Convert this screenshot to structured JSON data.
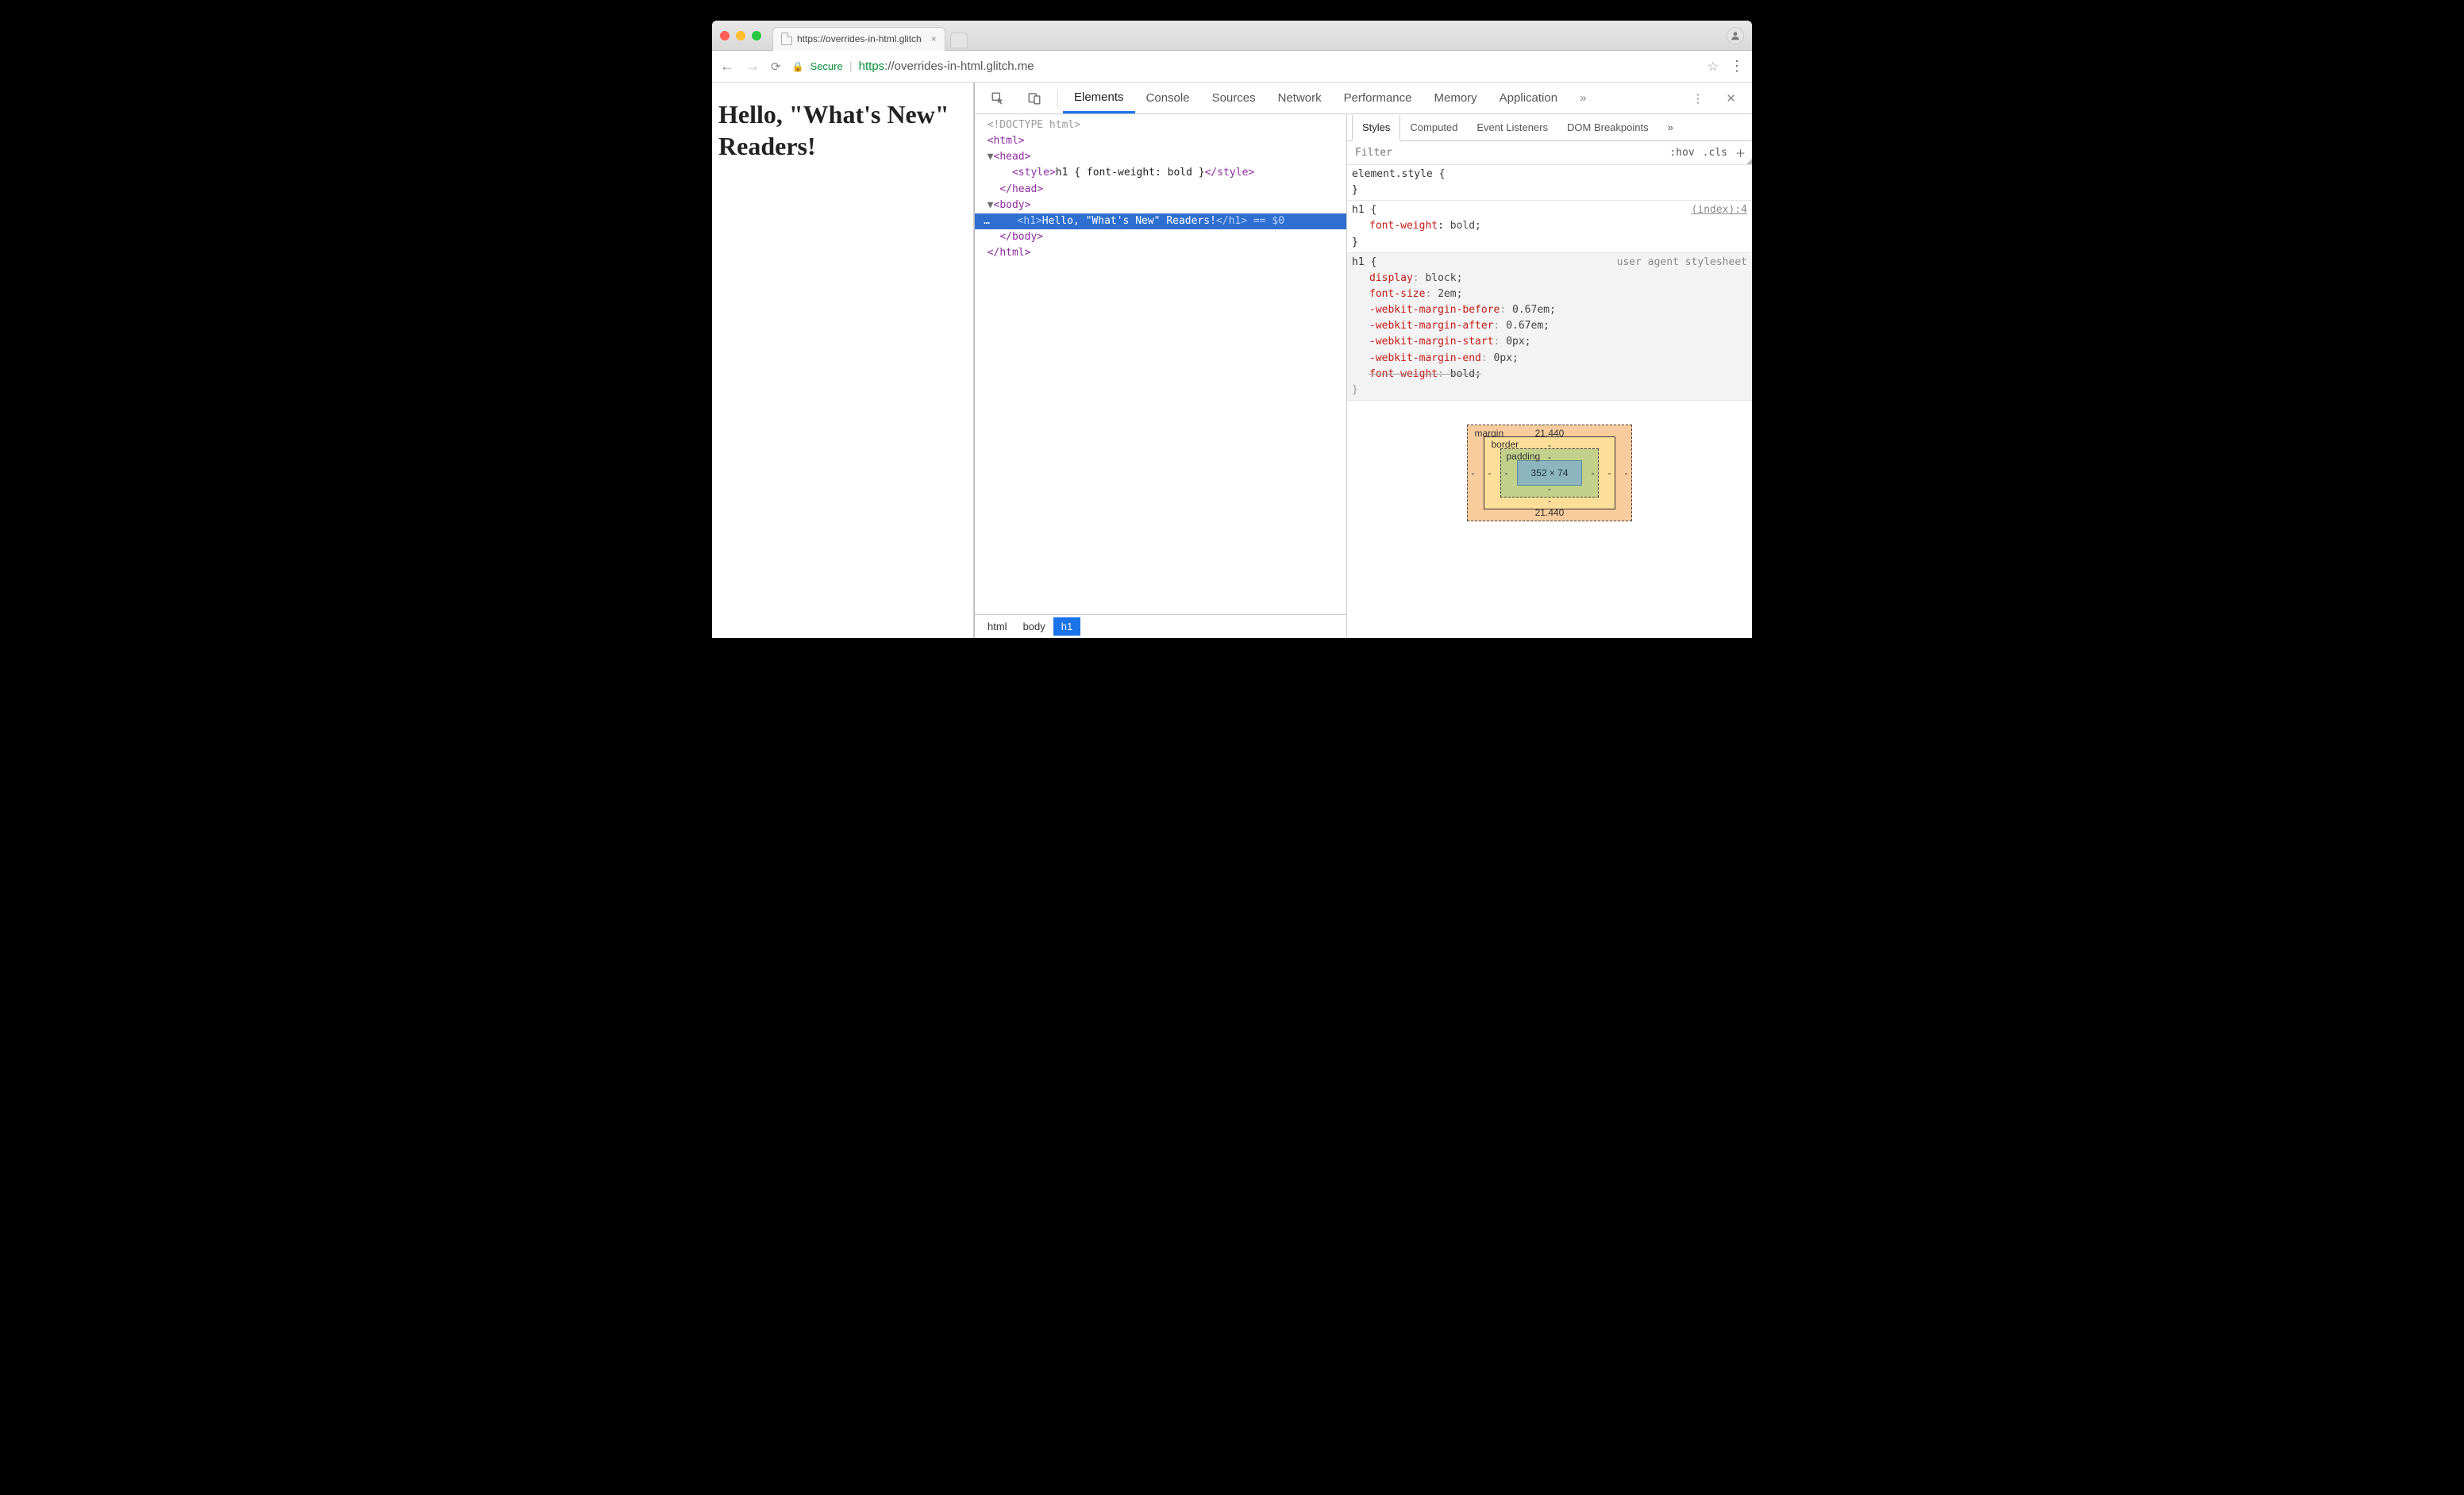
{
  "browser": {
    "tab_title": "https://overrides-in-html.glitch",
    "secure_label": "Secure",
    "url_scheme": "https",
    "url_rest": "://overrides-in-html.glitch.me"
  },
  "page": {
    "heading": "Hello, \"What's New\" Readers!"
  },
  "devtools": {
    "tabs": [
      "Elements",
      "Console",
      "Sources",
      "Network",
      "Performance",
      "Memory",
      "Application"
    ],
    "overflow": "»",
    "styles_tabs": [
      "Styles",
      "Computed",
      "Event Listeners",
      "DOM Breakpoints"
    ],
    "filter_placeholder": "Filter",
    "hov": ":hov",
    "cls": ".cls"
  },
  "dom": {
    "doctype": "<!DOCTYPE html>",
    "html_open": "html",
    "head_open": "head",
    "style_open": "style",
    "style_text": "h1 { font-weight: bold }",
    "style_close": "style",
    "head_close": "head",
    "body_open": "body",
    "h1_open": "h1",
    "h1_text": "Hello, \"What's New\" Readers!",
    "h1_close": "h1",
    "body_close": "body",
    "html_close": "html",
    "eq_var": "== $0"
  },
  "breadcrumbs": [
    "html",
    "body",
    "h1"
  ],
  "rules": {
    "r0": {
      "selector": "element.style {",
      "close": "}"
    },
    "r1": {
      "selector": "h1 {",
      "source": "(index):4",
      "props": [
        {
          "n": "font-weight",
          "v": "bold;"
        }
      ],
      "close": "}"
    },
    "r2": {
      "selector": "h1 {",
      "source": "user agent stylesheet",
      "props": [
        {
          "n": "display",
          "v": "block;"
        },
        {
          "n": "font-size",
          "v": "2em;"
        },
        {
          "n": "-webkit-margin-before",
          "v": "0.67em;"
        },
        {
          "n": "-webkit-margin-after",
          "v": "0.67em;"
        },
        {
          "n": "-webkit-margin-start",
          "v": "0px;"
        },
        {
          "n": "-webkit-margin-end",
          "v": "0px;"
        },
        {
          "n": "font-weight",
          "v": "bold;",
          "strike": true
        }
      ],
      "close": "}"
    }
  },
  "boxmodel": {
    "margin": {
      "label": "margin",
      "top": "21.440",
      "bottom": "21.440",
      "left": "-",
      "right": "-"
    },
    "border": {
      "label": "border",
      "top": "-",
      "bottom": "-",
      "left": "-",
      "right": "-"
    },
    "padding": {
      "label": "padding",
      "top": "-",
      "bottom": "-",
      "left": "-",
      "right": "-"
    },
    "content": "352 × 74"
  }
}
